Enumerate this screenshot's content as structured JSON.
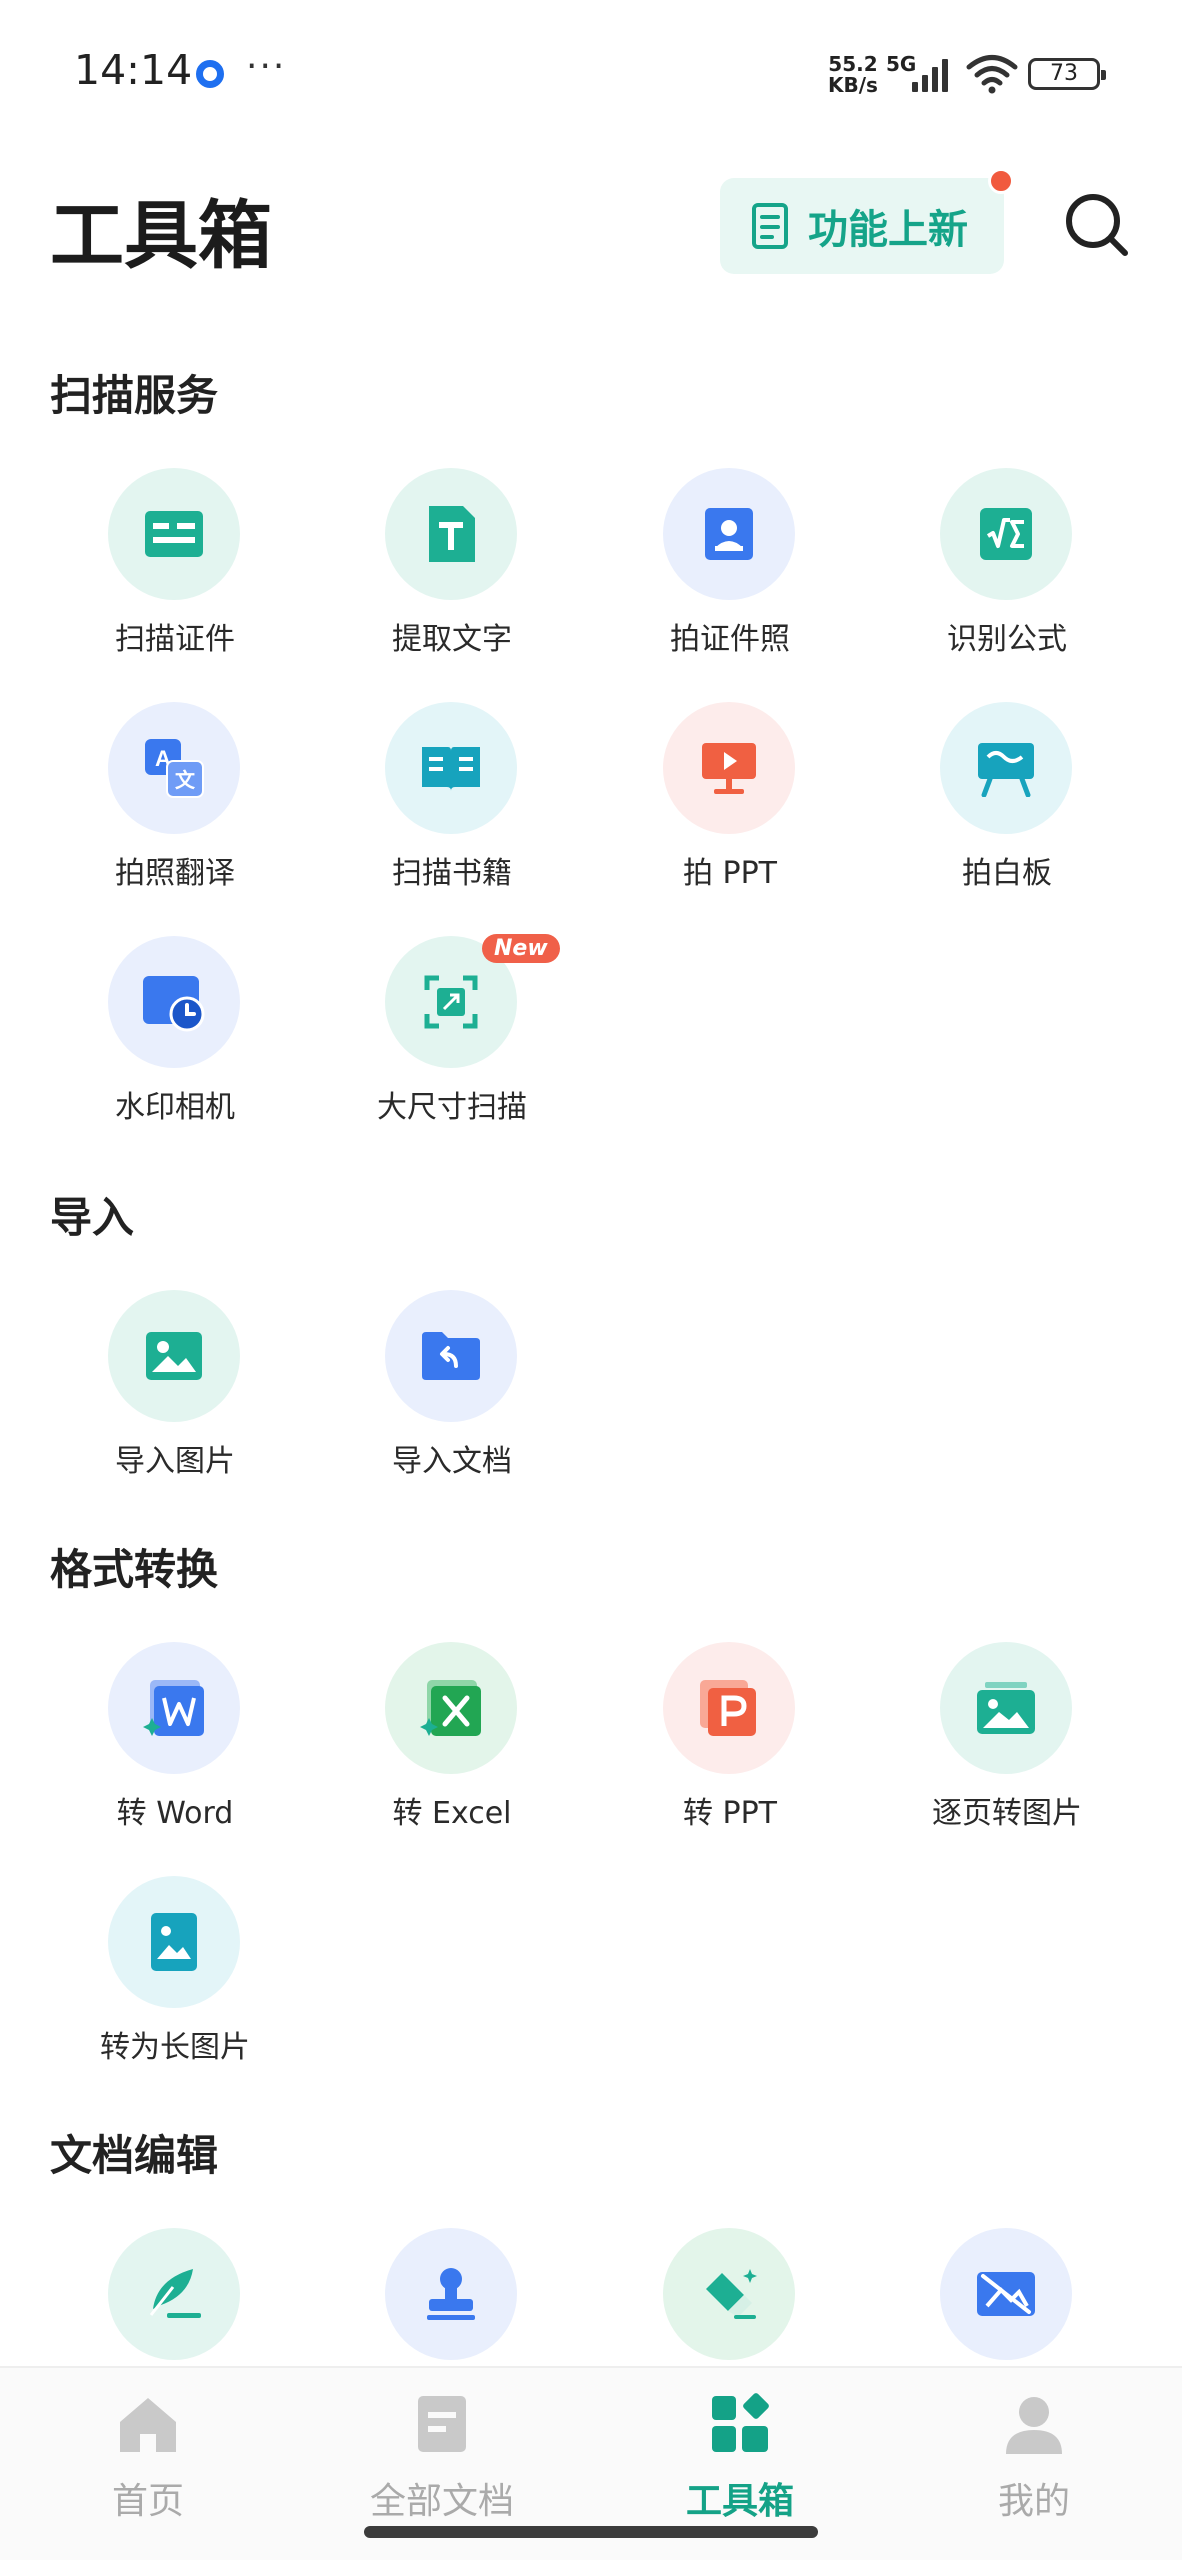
{
  "status_bar": {
    "time": "14:14",
    "net_speed_value": "55.2",
    "net_speed_unit": "KB/s",
    "network": "5G",
    "battery": "73"
  },
  "header": {
    "title": "工具箱",
    "new_features_label": "功能上新"
  },
  "sections": {
    "scan": {
      "title": "扫描服务",
      "items": [
        "扫描证件",
        "提取文字",
        "拍证件照",
        "识别公式",
        "拍照翻译",
        "扫描书籍",
        "拍 PPT",
        "拍白板",
        "水印相机",
        "大尺寸扫描"
      ],
      "new_badge": "New"
    },
    "import": {
      "title": "导入",
      "items": [
        "导入图片",
        "导入文档"
      ]
    },
    "convert": {
      "title": "格式转换",
      "items": [
        "转 Word",
        "转 Excel",
        "转 PPT",
        "逐页转图片",
        "转为长图片"
      ]
    },
    "edit": {
      "title": "文档编辑"
    }
  },
  "bottom_nav": {
    "items": [
      "首页",
      "全部文档",
      "工具箱",
      "我的"
    ],
    "active": "工具箱"
  },
  "colors": {
    "accent": "#14a287",
    "teal_bg": "#e6f7f2",
    "blue_bg": "#eaf0fd",
    "red_bg": "#fdecea",
    "cyan_bg": "#e4f6fb"
  }
}
